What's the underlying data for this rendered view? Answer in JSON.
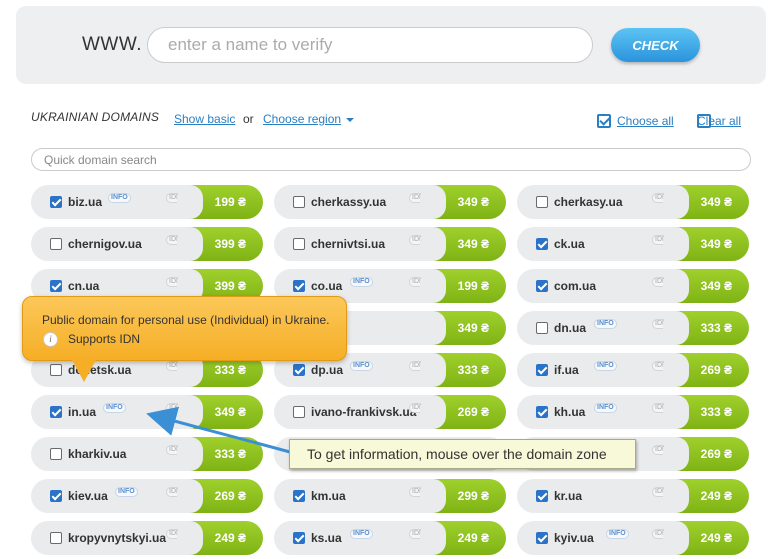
{
  "search": {
    "prefix": "WWW.",
    "placeholder": "enter a name to verify",
    "check_label": "CHECK"
  },
  "section": {
    "title": "UKRAINIAN DOMAINS",
    "show_basic": "Show basic",
    "or": "or",
    "choose_region": "Choose region",
    "choose_all": "Choose all",
    "clear_all": "Clear all",
    "choose_all_checked": true,
    "clear_all_checked": false
  },
  "quick_search": {
    "placeholder": "Quick domain search"
  },
  "domains": [
    {
      "name": "biz.ua",
      "info": true,
      "idn": true,
      "price": "199 ₴",
      "checked": true
    },
    {
      "name": "cherkassy.ua",
      "info": false,
      "idn": true,
      "price": "349 ₴",
      "checked": false
    },
    {
      "name": "cherkasy.ua",
      "info": false,
      "idn": true,
      "price": "349 ₴",
      "checked": false
    },
    {
      "name": "chernigov.ua",
      "info": false,
      "idn": true,
      "price": "399 ₴",
      "checked": false
    },
    {
      "name": "chernivtsi.ua",
      "info": false,
      "idn": true,
      "price": "349 ₴",
      "checked": false
    },
    {
      "name": "ck.ua",
      "info": false,
      "idn": true,
      "price": "349 ₴",
      "checked": true
    },
    {
      "name": "cn.ua",
      "info": false,
      "idn": true,
      "price": "399 ₴",
      "checked": true
    },
    {
      "name": "co.ua",
      "info": true,
      "idn": true,
      "price": "199 ₴",
      "checked": true
    },
    {
      "name": "com.ua",
      "info": false,
      "idn": true,
      "price": "349 ₴",
      "checked": true
    },
    {
      "name": "",
      "info": false,
      "idn": false,
      "price": "",
      "checked": false
    },
    {
      "name": "",
      "info": false,
      "idn": false,
      "price": "349 ₴",
      "checked": false
    },
    {
      "name": "dn.ua",
      "info": true,
      "idn": true,
      "price": "333 ₴",
      "checked": false
    },
    {
      "name": "donetsk.ua",
      "info": false,
      "idn": true,
      "price": "333 ₴",
      "checked": false
    },
    {
      "name": "dp.ua",
      "info": true,
      "idn": true,
      "price": "333 ₴",
      "checked": true
    },
    {
      "name": "if.ua",
      "info": true,
      "idn": true,
      "price": "269 ₴",
      "checked": true
    },
    {
      "name": "in.ua",
      "info": true,
      "idn": true,
      "price": "349 ₴",
      "checked": true
    },
    {
      "name": "ivano-frankivsk.ua",
      "info": false,
      "idn": true,
      "price": "269 ₴",
      "checked": false
    },
    {
      "name": "kh.ua",
      "info": true,
      "idn": true,
      "price": "333 ₴",
      "checked": true
    },
    {
      "name": "kharkiv.ua",
      "info": false,
      "idn": true,
      "price": "333 ₴",
      "checked": false
    },
    {
      "name": "",
      "info": false,
      "idn": false,
      "price": "",
      "checked": false
    },
    {
      "name": "",
      "info": false,
      "idn": true,
      "price": "269 ₴",
      "checked": false
    },
    {
      "name": "kiev.ua",
      "info": true,
      "idn": true,
      "price": "269 ₴",
      "checked": true
    },
    {
      "name": "km.ua",
      "info": false,
      "idn": true,
      "price": "299 ₴",
      "checked": true
    },
    {
      "name": "kr.ua",
      "info": false,
      "idn": true,
      "price": "249 ₴",
      "checked": true
    },
    {
      "name": "kropyvnytskyi.ua",
      "info": false,
      "idn": true,
      "price": "249 ₴",
      "checked": false
    },
    {
      "name": "ks.ua",
      "info": true,
      "idn": true,
      "price": "249 ₴",
      "checked": true
    },
    {
      "name": "kyiv.ua",
      "info": true,
      "idn": true,
      "price": "249 ₴",
      "checked": true
    }
  ],
  "labels": {
    "info": "INFO",
    "idn": "IDN"
  },
  "tooltip": {
    "text": "Public domain for personal use (Individual) in Ukraine.",
    "icon_letter": "i",
    "idn_text": "Supports IDN"
  },
  "annotation": {
    "text": "To get information, mouse over the domain zone"
  }
}
